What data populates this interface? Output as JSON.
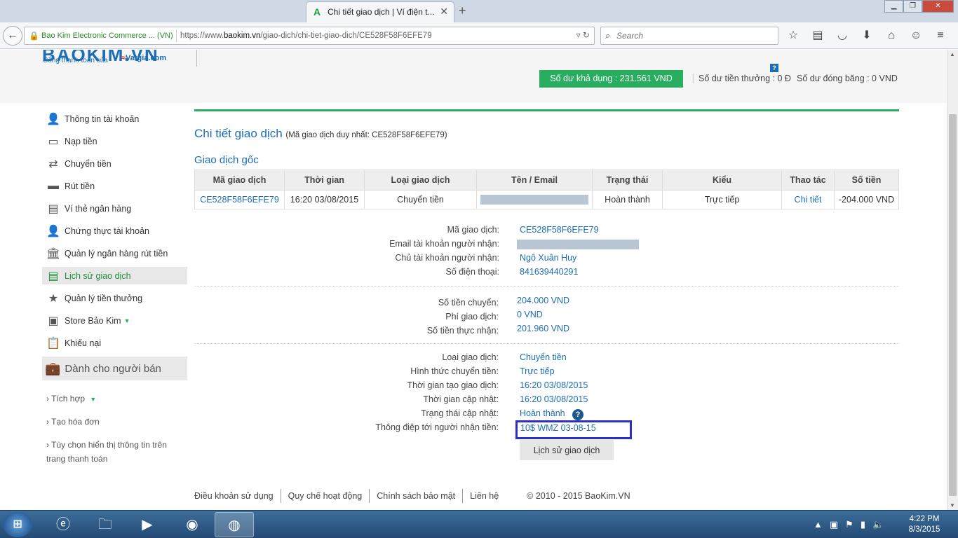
{
  "browser": {
    "tab_title": "Chi tiết giao dịch | Ví điện t...",
    "tab_favicon": "A",
    "site_identity": "Bao Kim Electronic Commerce ... (VN)",
    "url_prefix": "https://www.",
    "url_domain": "baokim.vn",
    "url_path": "/giao-dich/chi-tiet-giao-dich/CE528F58F6EFE79",
    "search_placeholder": "Search"
  },
  "header": {
    "logo_tagline": "Cổng thanh toán của",
    "logo_partner": "Vatgia.com",
    "balance": "Số dư khả dụng : 231.561 VND",
    "help": "?",
    "bonus": "Số dư tiền thưởng : 0 Đ",
    "frozen": "Số dư đóng băng : 0 VND"
  },
  "sidebar": {
    "items": [
      {
        "label": "Thông tin tài khoản",
        "icon": "user-icon"
      },
      {
        "label": "Nạp tiền",
        "icon": "deposit-icon"
      },
      {
        "label": "Chuyển tiền",
        "icon": "transfer-icon"
      },
      {
        "label": "Rút tiền",
        "icon": "withdraw-icon"
      },
      {
        "label": "Ví thẻ ngân hàng",
        "icon": "card-icon"
      },
      {
        "label": "Chứng thực tài khoản",
        "icon": "verify-icon"
      },
      {
        "label": "Quản lý ngân hàng rút tiền",
        "icon": "bank-icon"
      },
      {
        "label": "Lịch sử giao dịch",
        "icon": "history-icon"
      },
      {
        "label": "Quản lý tiền thưởng",
        "icon": "bonus-icon"
      },
      {
        "label": "Store Bảo Kim",
        "icon": "store-icon"
      },
      {
        "label": "Khiếu nại",
        "icon": "complaint-icon"
      }
    ],
    "seller_title": "Dành cho người bán",
    "seller_items": [
      "Tích hợp",
      "Tạo hóa đơn",
      "Tùy chọn hiển thị thông tin trên trang thanh toán"
    ]
  },
  "main": {
    "title": "Chi tiết giao dịch",
    "unique_id": "(Mã giao dịch duy nhất: CE528F58F6EFE79)",
    "section": "Giao dịch gốc",
    "table": {
      "headers": [
        "Mã giao dịch",
        "Thời gian",
        "Loại giao dịch",
        "Tên / Email",
        "Trạng thái",
        "Kiểu",
        "Thao tác",
        "Số tiền"
      ],
      "row": [
        "CE528F58F6EFE79",
        "16:20 03/08/2015",
        "Chuyển tiền",
        "",
        "Hoàn thành",
        "Trực tiếp",
        "Chi tiết",
        "-204.000 VND"
      ]
    },
    "details": {
      "code_label": "Mã giao dịch:",
      "code": "CE528F58F6EFE79",
      "email_label": "Email tài khoản người nhận:",
      "owner_label": "Chủ tài khoản người nhận:",
      "owner": "Ngô Xuân Huy",
      "phone_label": "Số điện thoại:",
      "phone": "841639440291",
      "amount_label": "Số tiền chuyển:",
      "amount": "204.000 VND",
      "fee_label": "Phí giao dịch:",
      "fee": "0 VND",
      "net_label": "Số tiền thực nhận:",
      "net": "201.960 VND",
      "type_label": "Loại giao dịch:",
      "type": "Chuyển tiền",
      "method_label": "Hình thức chuyển tiền:",
      "method": "Trực tiếp",
      "created_label": "Thời gian tạo giao dịch:",
      "created": "16:20 03/08/2015",
      "updated_label": "Thời gian cập nhật:",
      "updated": "16:20 03/08/2015",
      "status_label": "Trạng thái cập nhật:",
      "status": "Hoàn thành",
      "message_label": "Thông điệp tới người nhận tiền:",
      "message": "10$ WMZ 03-08-15"
    },
    "history_button": "Lịch sử giao dịch"
  },
  "footer": {
    "links": [
      "Điều khoản sử dụng",
      "Quy chế hoạt động",
      "Chính sách bảo mật",
      "Liên hệ"
    ],
    "copyright": "© 2010 - 2015 BaoKim.VN"
  },
  "taskbar": {
    "time": "4:22 PM",
    "date": "8/3/2015"
  }
}
